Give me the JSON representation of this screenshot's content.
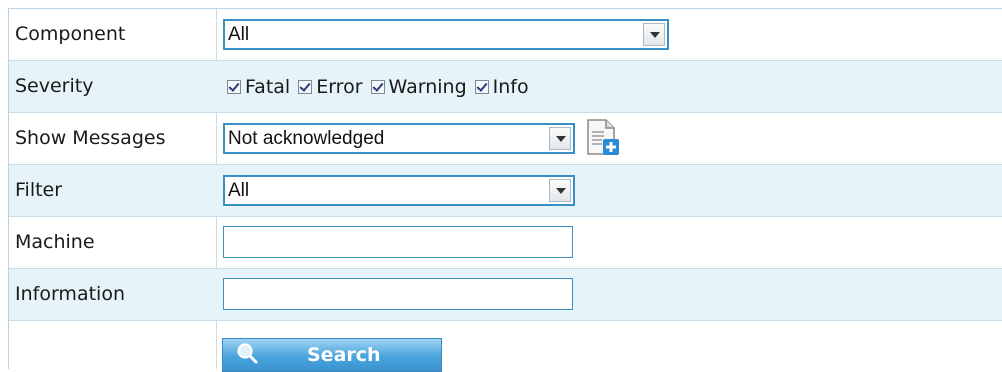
{
  "component": {
    "label": "Component",
    "value": "All"
  },
  "severity": {
    "label": "Severity",
    "options": [
      {
        "label": "Fatal",
        "checked": true
      },
      {
        "label": "Error",
        "checked": true
      },
      {
        "label": "Warning",
        "checked": true
      },
      {
        "label": "Info",
        "checked": true
      }
    ]
  },
  "show_messages": {
    "label": "Show Messages",
    "value": "Not acknowledged",
    "add_icon": "new-document-icon"
  },
  "filter": {
    "label": "Filter",
    "value": "All"
  },
  "machine": {
    "label": "Machine",
    "value": ""
  },
  "information": {
    "label": "Information",
    "value": ""
  },
  "search_button": {
    "label": "Search",
    "icon": "magnifier-icon"
  },
  "colors": {
    "accent": "#3a8fc4",
    "row_alt": "#e6f3f9",
    "button": "#4aa4dc"
  }
}
